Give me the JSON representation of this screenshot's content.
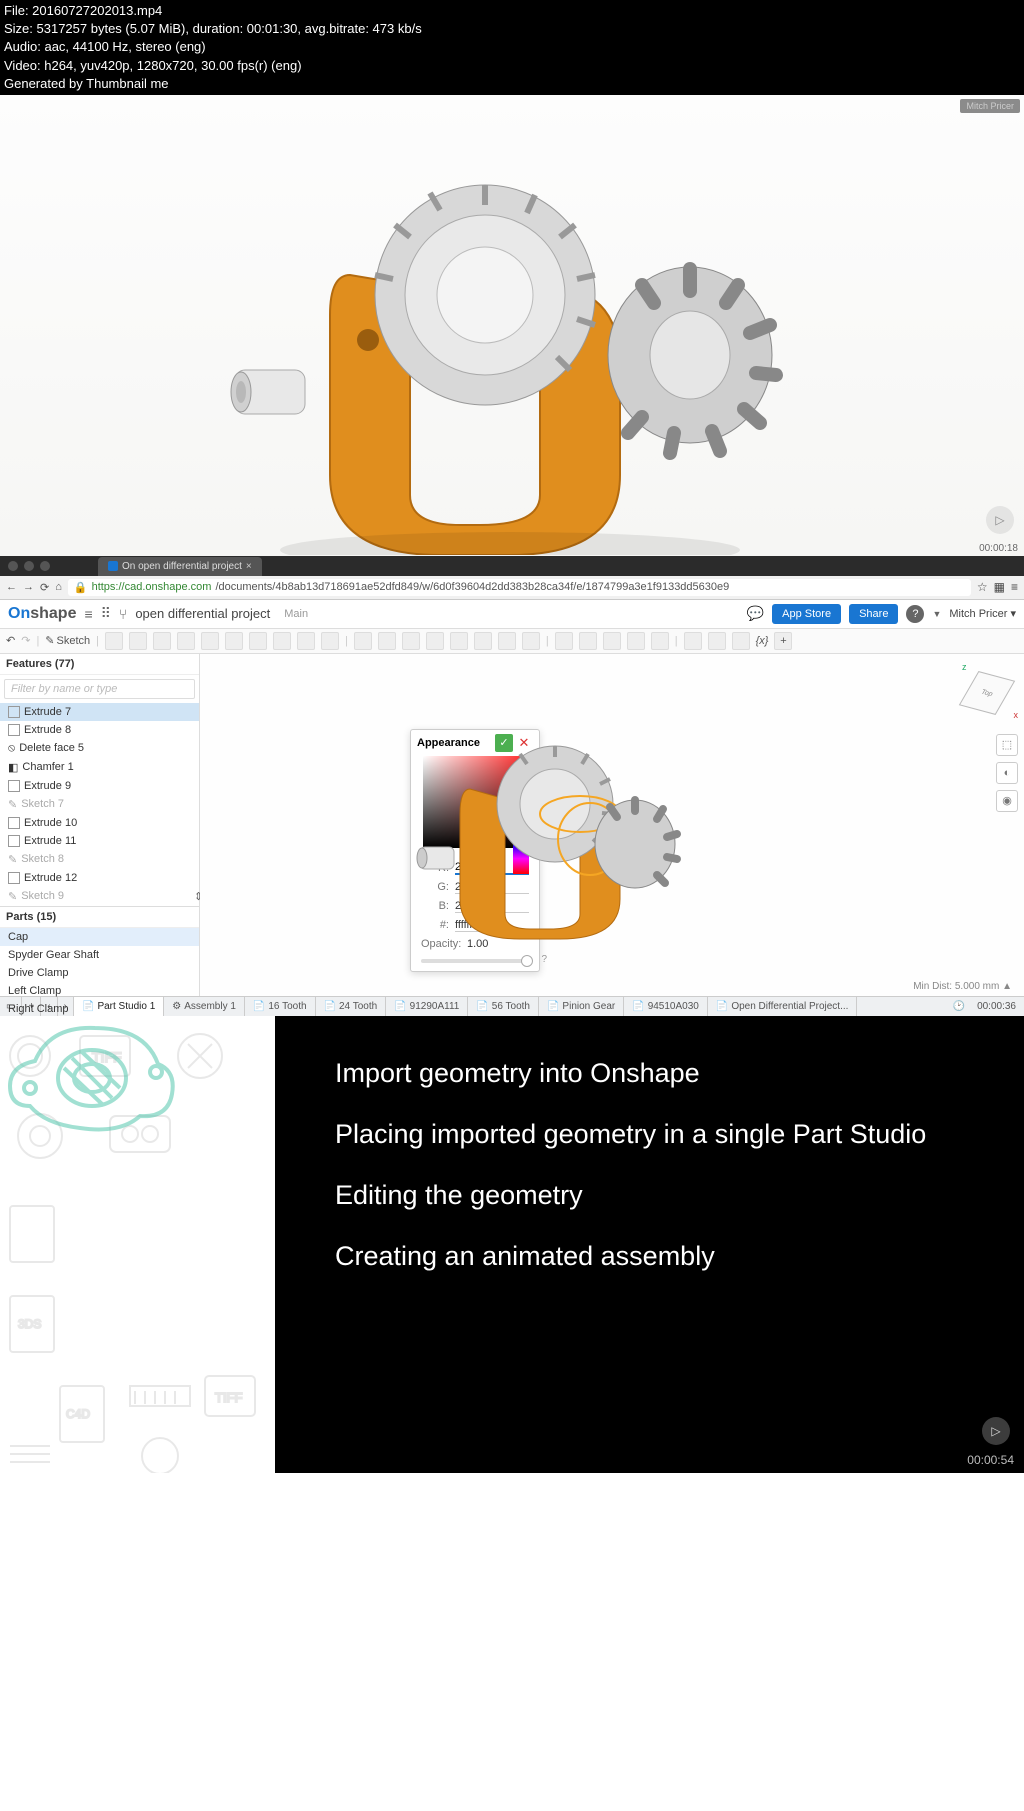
{
  "meta": {
    "file": "File: 20160727202013.mp4",
    "size": "Size: 5317257 bytes (5.07 MiB), duration: 00:01:30, avg.bitrate: 473 kb/s",
    "audio": "Audio: aac, 44100 Hz, stereo (eng)",
    "video": "Video: h264, yuv420p, 1280x720, 30.00 fps(r) (eng)",
    "gen": "Generated by Thumbnail me"
  },
  "frame1": {
    "timer": "00:00:18",
    "badge": "Mitch Pricer"
  },
  "browser": {
    "tab": "On open differential project",
    "url_host": "https://cad.onshape.com",
    "url_rest": "/documents/4b8ab13d718691ae52dfd849/w/6d0f39604d2dd383b28ca34f/e/1874799a3e1f9133dd5630e9"
  },
  "header": {
    "logo_on": "On",
    "logo_shape": "shape",
    "doc": "open differential project",
    "section": "Main",
    "appstore": "App Store",
    "share": "Share",
    "user": "Mitch Pricer"
  },
  "toolbar": {
    "sketch": "Sketch",
    "var": "{x}"
  },
  "sidebar": {
    "features_hdr": "Features (77)",
    "filter_ph": "Filter by name or type",
    "feat": [
      "Extrude 7",
      "Extrude 8",
      "Delete face 5",
      "Chamfer 1",
      "Extrude 9",
      "Sketch 7",
      "Extrude 10",
      "Extrude 11",
      "Sketch 8",
      "Extrude 12",
      "Sketch 9"
    ],
    "parts_hdr": "Parts (15)",
    "parts": [
      "Cap",
      "Spyder Gear Shaft",
      "Drive Clamp",
      "Left Clamp",
      "Right Clamp"
    ]
  },
  "appearance": {
    "title": "Appearance",
    "r_l": "R:",
    "r": "255",
    "g_l": "G:",
    "g": "255",
    "b_l": "B:",
    "b": "255",
    "h_l": "#:",
    "hex": "ffffff",
    "op_l": "Opacity:",
    "op": "1.00"
  },
  "viewport": {
    "mindist": "Min Dist: 5.000 mm ▲"
  },
  "btabs": {
    "items": [
      "Part Studio 1",
      "Assembly 1",
      "16 Tooth",
      "24 Tooth",
      "91290A111",
      "56 Tooth",
      "Pinion Gear",
      "94510A030",
      "Open Differential Project..."
    ],
    "timer": "00:00:36"
  },
  "frame3": {
    "lines": [
      "Import geometry into Onshape",
      "Placing imported geometry in a single Part Studio",
      "Editing the geometry",
      "Creating an animated assembly"
    ],
    "timer": "00:00:54"
  }
}
